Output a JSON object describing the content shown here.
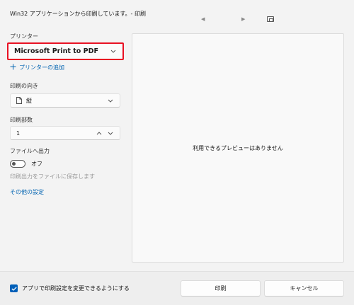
{
  "window": {
    "title": "Win32 アプリケーションから印刷しています。- 印刷"
  },
  "printer": {
    "label": "プリンター",
    "selected": "Microsoft Print to PDF",
    "add_label": "プリンターの追加"
  },
  "orientation": {
    "label": "印刷の向き",
    "selected": "縦"
  },
  "copies": {
    "label": "印刷部数",
    "value": "1"
  },
  "file_output": {
    "label": "ファイルへ出力",
    "toggle_state": "オフ",
    "hint": "印刷出力をファイルに保存します"
  },
  "other_settings": {
    "label": "その他の設定"
  },
  "preview": {
    "message": "利用できるプレビューはありません"
  },
  "footer": {
    "checkbox_label": "アプリで印刷設定を変更できるようにする",
    "checkbox_checked": true,
    "print_button": "印刷",
    "cancel_button": "キャンセル"
  },
  "colors": {
    "accent": "#005fb8",
    "link": "#0063b1",
    "highlight_border": "#e81123"
  }
}
